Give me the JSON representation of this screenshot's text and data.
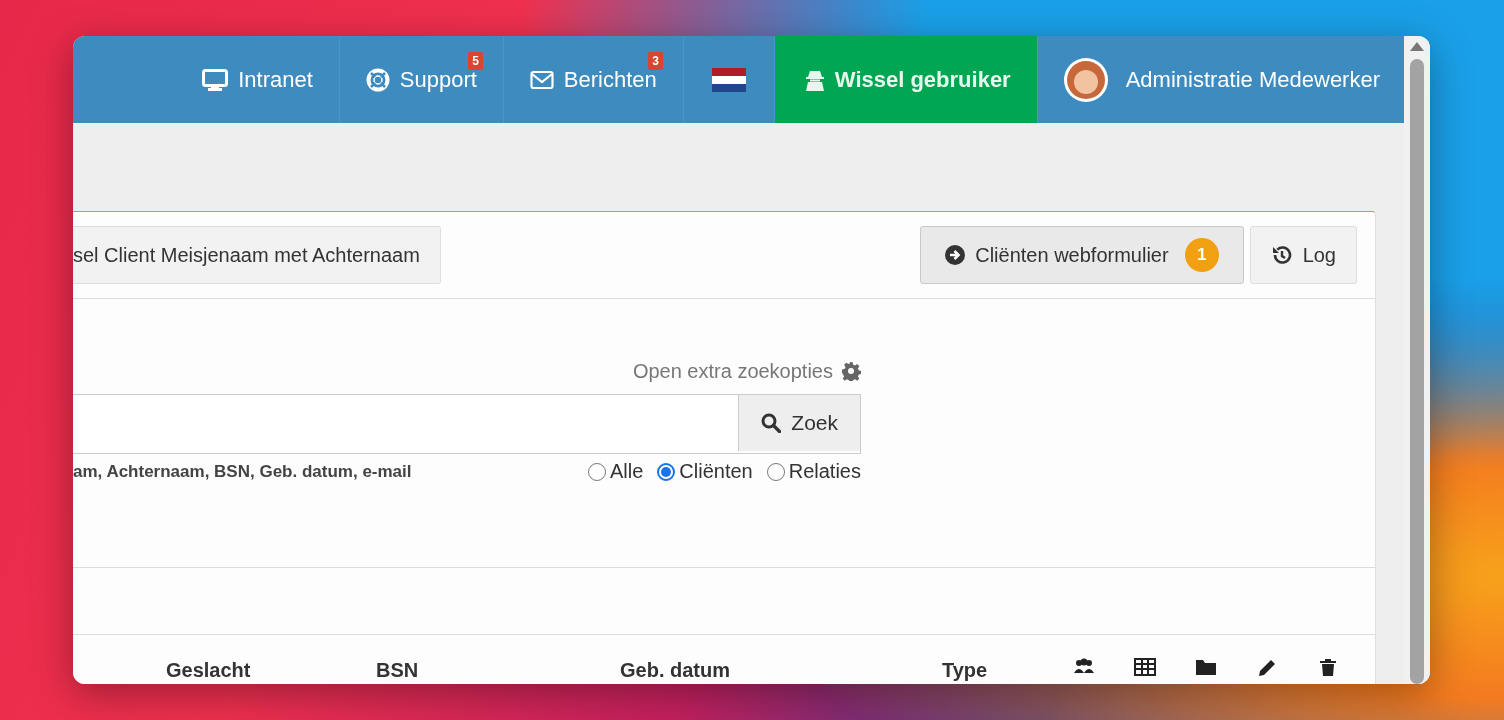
{
  "navbar": {
    "items": [
      {
        "kind": "link",
        "label": "Intranet"
      },
      {
        "kind": "link",
        "label": "Support",
        "badge": "5"
      },
      {
        "kind": "link",
        "label": "Berichten",
        "badge": "3"
      },
      {
        "kind": "flag"
      },
      {
        "kind": "switch",
        "label": "Wissel gebruiker"
      },
      {
        "kind": "user",
        "label": "Administratie Medewerker"
      }
    ]
  },
  "toolbar": {
    "left_button": "sel Client Meisjenaam met Achternaam",
    "right_buttons": [
      {
        "label": "Cliënten webformulier",
        "badge": "1"
      },
      {
        "label": "Log"
      }
    ]
  },
  "search": {
    "options_link": "Open extra zoekopties",
    "button": "Zoek",
    "hint": "am, Achternaam, BSN, Geb. datum, e-mail",
    "filters": [
      {
        "label": "Alle",
        "selected": false
      },
      {
        "label": "Cliënten",
        "selected": true
      },
      {
        "label": "Relaties",
        "selected": false
      }
    ]
  },
  "table": {
    "columns": [
      "Geslacht",
      "BSN",
      "Geb. datum",
      "Type"
    ]
  }
}
